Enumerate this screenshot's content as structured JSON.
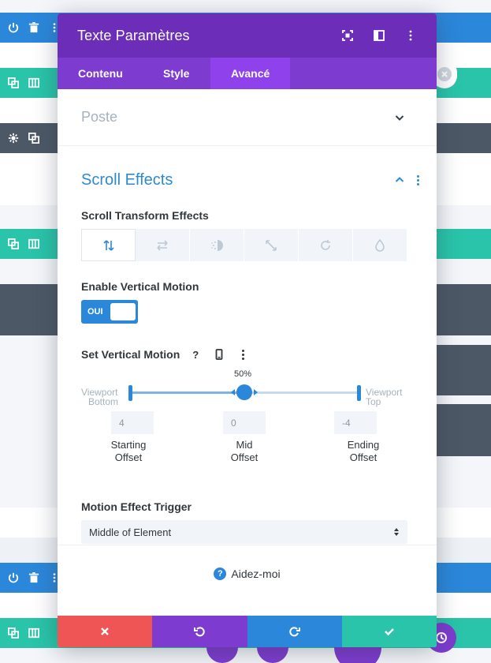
{
  "modal": {
    "title": "Texte Paramètres",
    "tabs": [
      "Contenu",
      "Style",
      "Avancé"
    ],
    "active_tab": "Avancé"
  },
  "sections": {
    "poste": {
      "title": "Poste"
    },
    "scroll_effects": {
      "title": "Scroll Effects",
      "transform_label": "Scroll Transform Effects",
      "transform_options": [
        "vertical-motion-icon",
        "horizontal-motion-icon",
        "fade-icon",
        "scale-icon",
        "rotate-icon",
        "blur-icon"
      ],
      "enable_label": "Enable Vertical Motion",
      "toggle_value": "OUI",
      "set_motion_label": "Set Vertical Motion",
      "percent": "50%",
      "viewport_bottom": [
        "Viewport",
        "Bottom"
      ],
      "viewport_top": [
        "Viewport",
        "Top"
      ],
      "offsets": {
        "starting": {
          "value": "4",
          "label": [
            "Starting",
            "Offset"
          ]
        },
        "mid": {
          "value": "0",
          "label": [
            "Mid",
            "Offset"
          ]
        },
        "ending": {
          "value": "-4",
          "label": [
            "Ending",
            "Offset"
          ]
        }
      },
      "trigger_label": "Motion Effect Trigger",
      "trigger_value": "Middle of Element"
    }
  },
  "help": {
    "label": "Aidez-moi"
  },
  "colors": {
    "purple_header": "#6c2eb9",
    "purple_tabs": "#7d3bcf",
    "active_tab": "#8f42ec",
    "accent_blue": "#2b87da",
    "teal": "#29c4a9",
    "red": "#ef5555",
    "slate": "#4c5866"
  }
}
